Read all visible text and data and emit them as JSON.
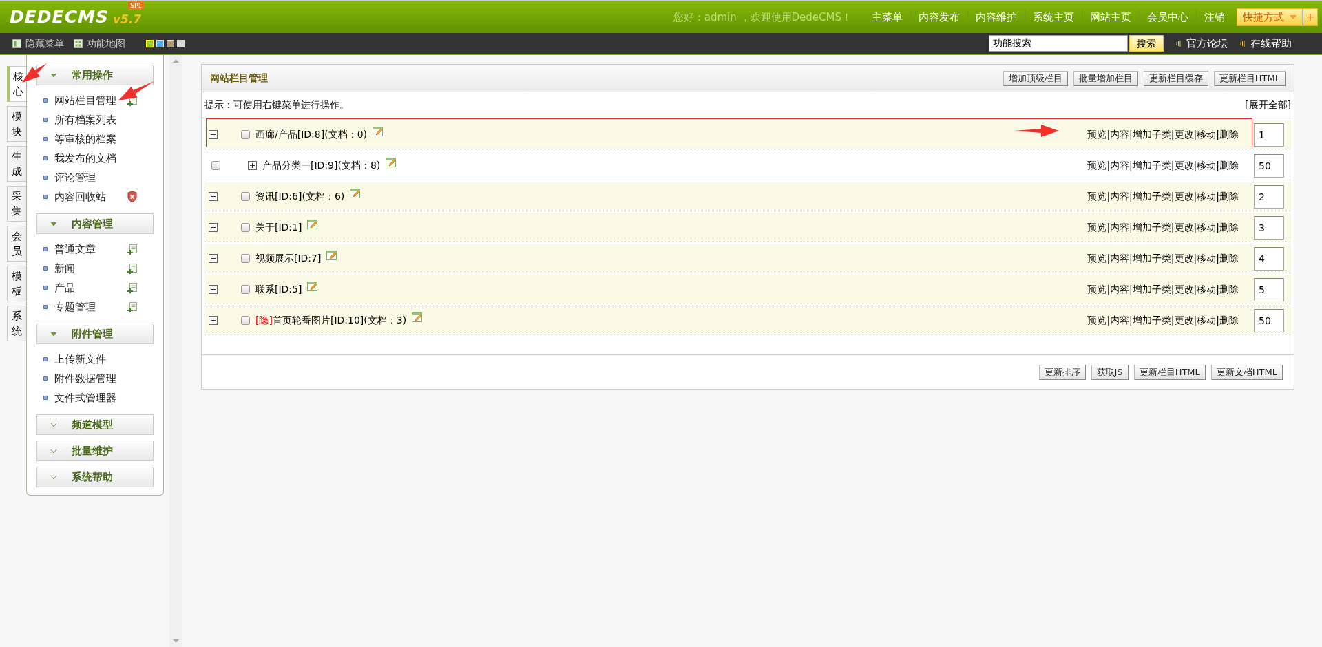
{
  "logo": {
    "name": "DEDECMS",
    "version": "v5.7",
    "badge": "SP1"
  },
  "top_nav": {
    "greeting": "您好：admin ，欢迎使用DedeCMS！",
    "items": [
      "主菜单",
      "内容发布",
      "内容维护",
      "系统主页",
      "网站主页",
      "会员中心",
      "注销"
    ],
    "shortcut": "快捷方式",
    "add": "+"
  },
  "toolbar": {
    "hide_menu": "隐藏菜单",
    "function_map": "功能地图",
    "skins": [
      {
        "color": "#9acd32",
        "selected": true
      },
      {
        "color": "#4db3e6",
        "selected": false
      },
      {
        "color": "#b89c72",
        "selected": false
      },
      {
        "color": "#d8d8d8",
        "selected": false
      }
    ],
    "search": {
      "value": "功能搜索",
      "button": "搜索"
    },
    "links": [
      "官方论坛",
      "在线帮助"
    ]
  },
  "side_tabs": [
    {
      "label": "核心",
      "selected": true
    },
    {
      "label": "模块",
      "selected": false
    },
    {
      "label": "生成",
      "selected": false
    },
    {
      "label": "采集",
      "selected": false
    },
    {
      "label": "会员",
      "selected": false
    },
    {
      "label": "模板",
      "selected": false
    },
    {
      "label": "系统",
      "selected": false
    }
  ],
  "menu_groups": [
    {
      "title": "常用操作",
      "expanded": true,
      "items": [
        {
          "label": "网站栏目管理",
          "kind": "add"
        },
        {
          "label": "所有档案列表",
          "kind": "plain"
        },
        {
          "label": "等审核的档案",
          "kind": "plain"
        },
        {
          "label": "我发布的文档",
          "kind": "plain"
        },
        {
          "label": "评论管理",
          "kind": "plain"
        },
        {
          "label": "内容回收站",
          "kind": "delete"
        }
      ]
    },
    {
      "title": "内容管理",
      "expanded": true,
      "items": [
        {
          "label": "普通文章",
          "kind": "add"
        },
        {
          "label": "新闻",
          "kind": "add"
        },
        {
          "label": "产品",
          "kind": "add"
        },
        {
          "label": "专题管理",
          "kind": "add"
        }
      ]
    },
    {
      "title": "附件管理",
      "expanded": true,
      "items": [
        {
          "label": "上传新文件",
          "kind": "plain"
        },
        {
          "label": "附件数据管理",
          "kind": "plain"
        },
        {
          "label": "文件式管理器",
          "kind": "plain"
        }
      ]
    },
    {
      "title": "频道模型",
      "expanded": false
    },
    {
      "title": "批量维护",
      "expanded": false
    },
    {
      "title": "系统帮助",
      "expanded": false
    }
  ],
  "panel": {
    "title": "网站栏目管理",
    "buttons": [
      "增加顶级栏目",
      "批量增加栏目",
      "更新栏目缓存",
      "更新栏目HTML"
    ],
    "hint": "提示：可使用右键菜单进行操作。",
    "expand_all": "[展开全部]",
    "rows": [
      {
        "name": "画廊/产品[ID:8](文档：0)",
        "expanded": true,
        "checked": false,
        "highlighted": true,
        "actions": "预览|内容|增加子类|更改|移动|删除",
        "order": "1",
        "children": [
          {
            "name": "产品分类一[ID:9](文档：8)",
            "expanded": false,
            "checked": false,
            "highlighted": false,
            "actions": "预览|内容|增加子类|更改|移动|删除",
            "order": "50"
          }
        ]
      },
      {
        "name": "资讯[ID:6](文档：6)",
        "expanded": false,
        "checked": false,
        "highlighted": false,
        "actions": "预览|内容|增加子类|更改|移动|删除",
        "order": "2"
      },
      {
        "name": "关于[ID:1]",
        "expanded": false,
        "checked": false,
        "highlighted": false,
        "actions": "预览|内容|增加子类|更改|移动|删除",
        "order": "3"
      },
      {
        "name": "视频展示[ID:7]",
        "expanded": false,
        "checked": false,
        "highlighted": false,
        "actions": "预览|内容|增加子类|更改|移动|删除",
        "order": "4"
      },
      {
        "name": "联系[ID:5]",
        "expanded": false,
        "checked": false,
        "highlighted": false,
        "actions": "预览|内容|增加子类|更改|移动|删除",
        "order": "5"
      },
      {
        "tag": "[隐]",
        "name": "首页轮番图片[ID:10](文档：3)",
        "expanded": false,
        "checked": false,
        "highlighted": false,
        "actions": "预览|内容|增加子类|更改|移动|删除",
        "order": "50"
      }
    ],
    "footer_buttons": [
      "更新排序",
      "获取JS",
      "更新栏目HTML",
      "更新文档HTML"
    ]
  }
}
